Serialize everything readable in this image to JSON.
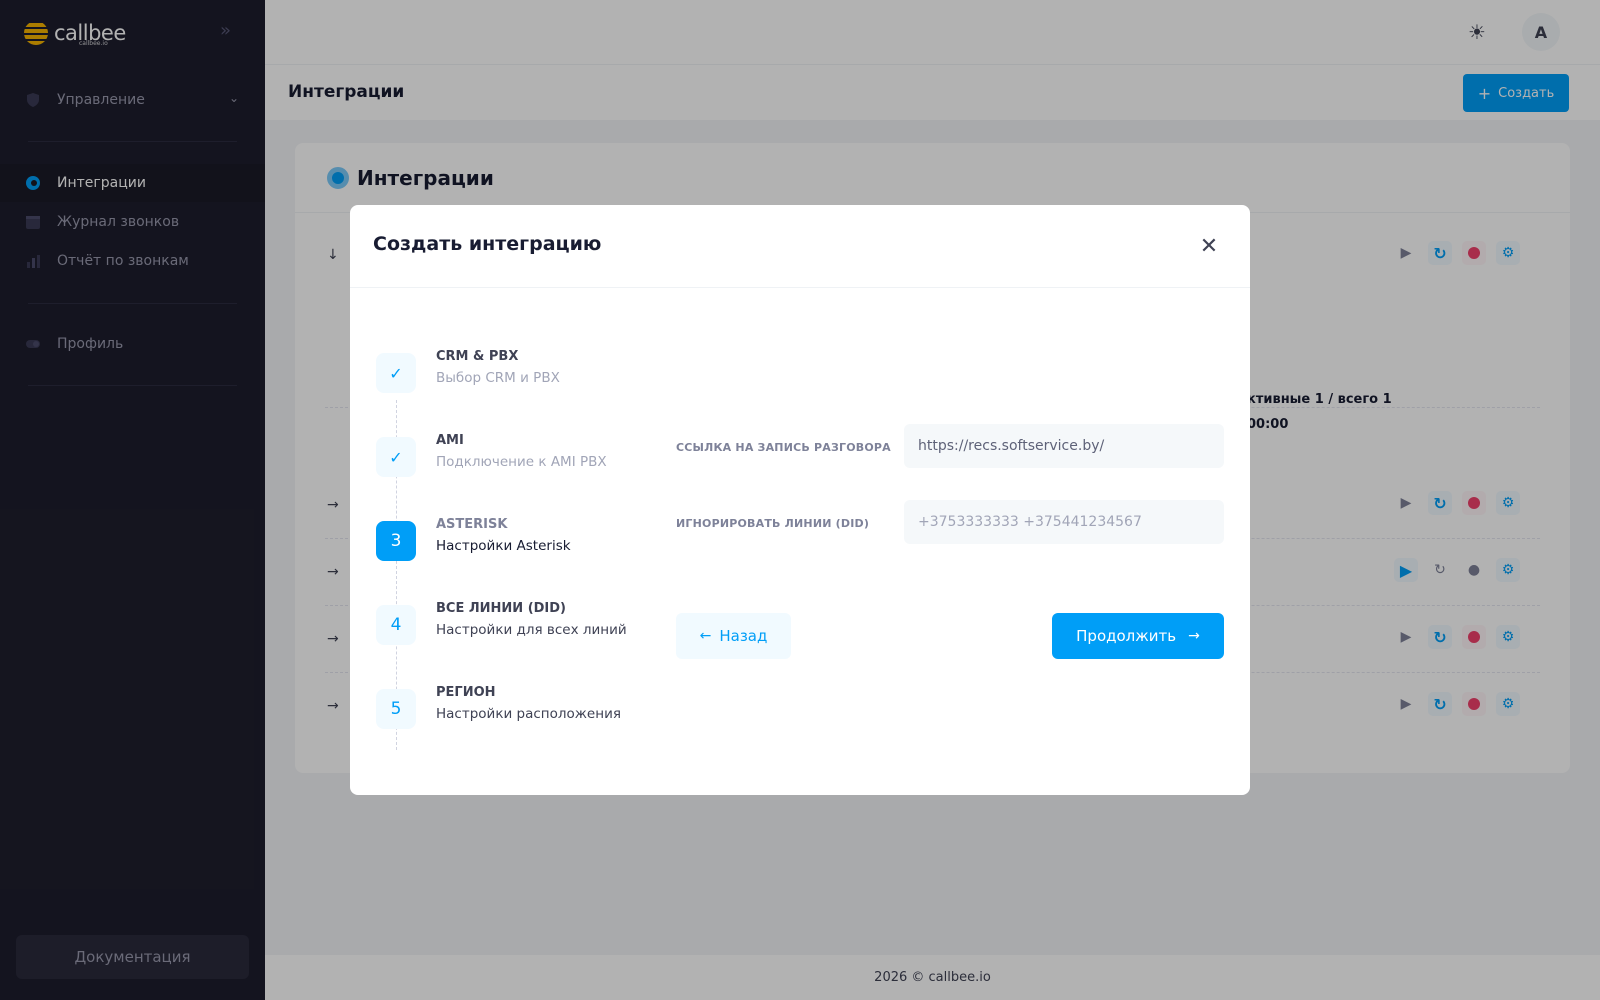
{
  "sidebar": {
    "logo_text": "callbee",
    "logo_sub": "callbee.io",
    "menu": [
      {
        "label": "Управление",
        "icon": "shield-icon"
      },
      {
        "label": "Интеграции",
        "icon": "integration-icon"
      },
      {
        "label": "Журнал звонков",
        "icon": "calendar-icon"
      },
      {
        "label": "Отчёт по звонкам",
        "icon": "bar-chart-icon"
      },
      {
        "label": "Профиль",
        "icon": "toggle-icon"
      }
    ],
    "docs_label": "Документация"
  },
  "header": {
    "avatar_letter": "A"
  },
  "toolbar": {
    "title": "Интеграции",
    "create_label": "Создать"
  },
  "card": {
    "title": "Интеграции",
    "stats_line1": "ктивные 1 / всего 1",
    "stats_line2": "00:00"
  },
  "modal": {
    "title": "Создать интеграцию",
    "steps": [
      {
        "number": "✓",
        "title": "CRM & PBX",
        "desc": "Выбор CRM и PBX",
        "state": "done"
      },
      {
        "number": "✓",
        "title": "AMI",
        "desc": "Подключение к AMI PBX",
        "state": "done"
      },
      {
        "number": "3",
        "title": "ASTERISK",
        "desc": "Настройки Asterisk",
        "state": "current"
      },
      {
        "number": "4",
        "title": "ВСЕ ЛИНИИ (DID)",
        "desc": "Настройки для всех линий",
        "state": "pending"
      },
      {
        "number": "5",
        "title": "РЕГИОН",
        "desc": "Настройки расположения",
        "state": "pending"
      }
    ],
    "fields": {
      "record_link_label": "ССЫЛКА НА ЗАПИСЬ РАЗГОВОРА",
      "record_link_value": "https://recs.softservice.by/",
      "ignore_lines_label": "ИГНОРИРОВАТЬ ЛИНИИ (DID)",
      "ignore_lines_placeholder": "+3753333333 +375441234567"
    },
    "back_label": "Назад",
    "next_label": "Продолжить"
  },
  "footer": {
    "text": "2026 © callbee.io"
  },
  "colors": {
    "primary": "#009ef7",
    "danger": "#f1416c",
    "sidebar_bg": "#1e1e2d",
    "logo_accent": "#f5b400"
  }
}
